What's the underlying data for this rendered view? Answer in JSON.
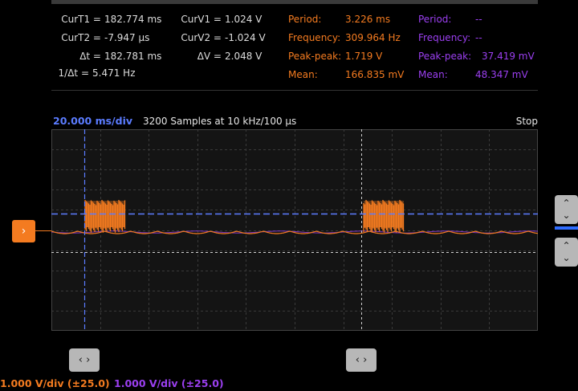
{
  "measurements": {
    "cursors": [
      {
        "label": "CurT1 =",
        "value": "182.774 ms"
      },
      {
        "label": "CurT2 =",
        "value": "-7.947 µs"
      },
      {
        "label": "Δt =",
        "value": "182.781 ms"
      },
      {
        "label": "1/Δt =",
        "value": "5.471 Hz"
      }
    ],
    "volt_cursors": [
      {
        "label": "CurV1 =",
        "value": "1.024 V"
      },
      {
        "label": "CurV2 =",
        "value": "-1.024 V"
      },
      {
        "label": "ΔV =",
        "value": "2.048 V"
      }
    ],
    "channel1": [
      {
        "label": "Period:",
        "value": "3.226 ms"
      },
      {
        "label": "Frequency:",
        "value": "309.964 Hz"
      },
      {
        "label": "Peak-peak:",
        "value": "1.719 V"
      },
      {
        "label": "Mean:",
        "value": "166.835 mV"
      }
    ],
    "channel2": [
      {
        "label": "Period:",
        "value": "--"
      },
      {
        "label": "Frequency:",
        "value": "--"
      },
      {
        "label": "Peak-peak:",
        "value": "37.419 mV"
      },
      {
        "label": "Mean:",
        "value": "48.347 mV"
      }
    ]
  },
  "timebar": {
    "time_div": "20.000 ms/div",
    "samples": "3200 Samples at 10 kHz/100 µs",
    "status": "Stop"
  },
  "footer": {
    "ch1_scale": "1.000 V/div (±25.0)",
    "ch2_scale": "1.000 V/div (±25.0)"
  },
  "icons": {
    "channel_marker": "chevron-right-icon",
    "updown": "chevron-up-down-icon",
    "leftright": "chevron-left-right-icon"
  },
  "colors": {
    "ch1": "#f47b20",
    "ch2": "#9b3ff0",
    "cursor": "#5b7cff",
    "background": "#141414"
  }
}
